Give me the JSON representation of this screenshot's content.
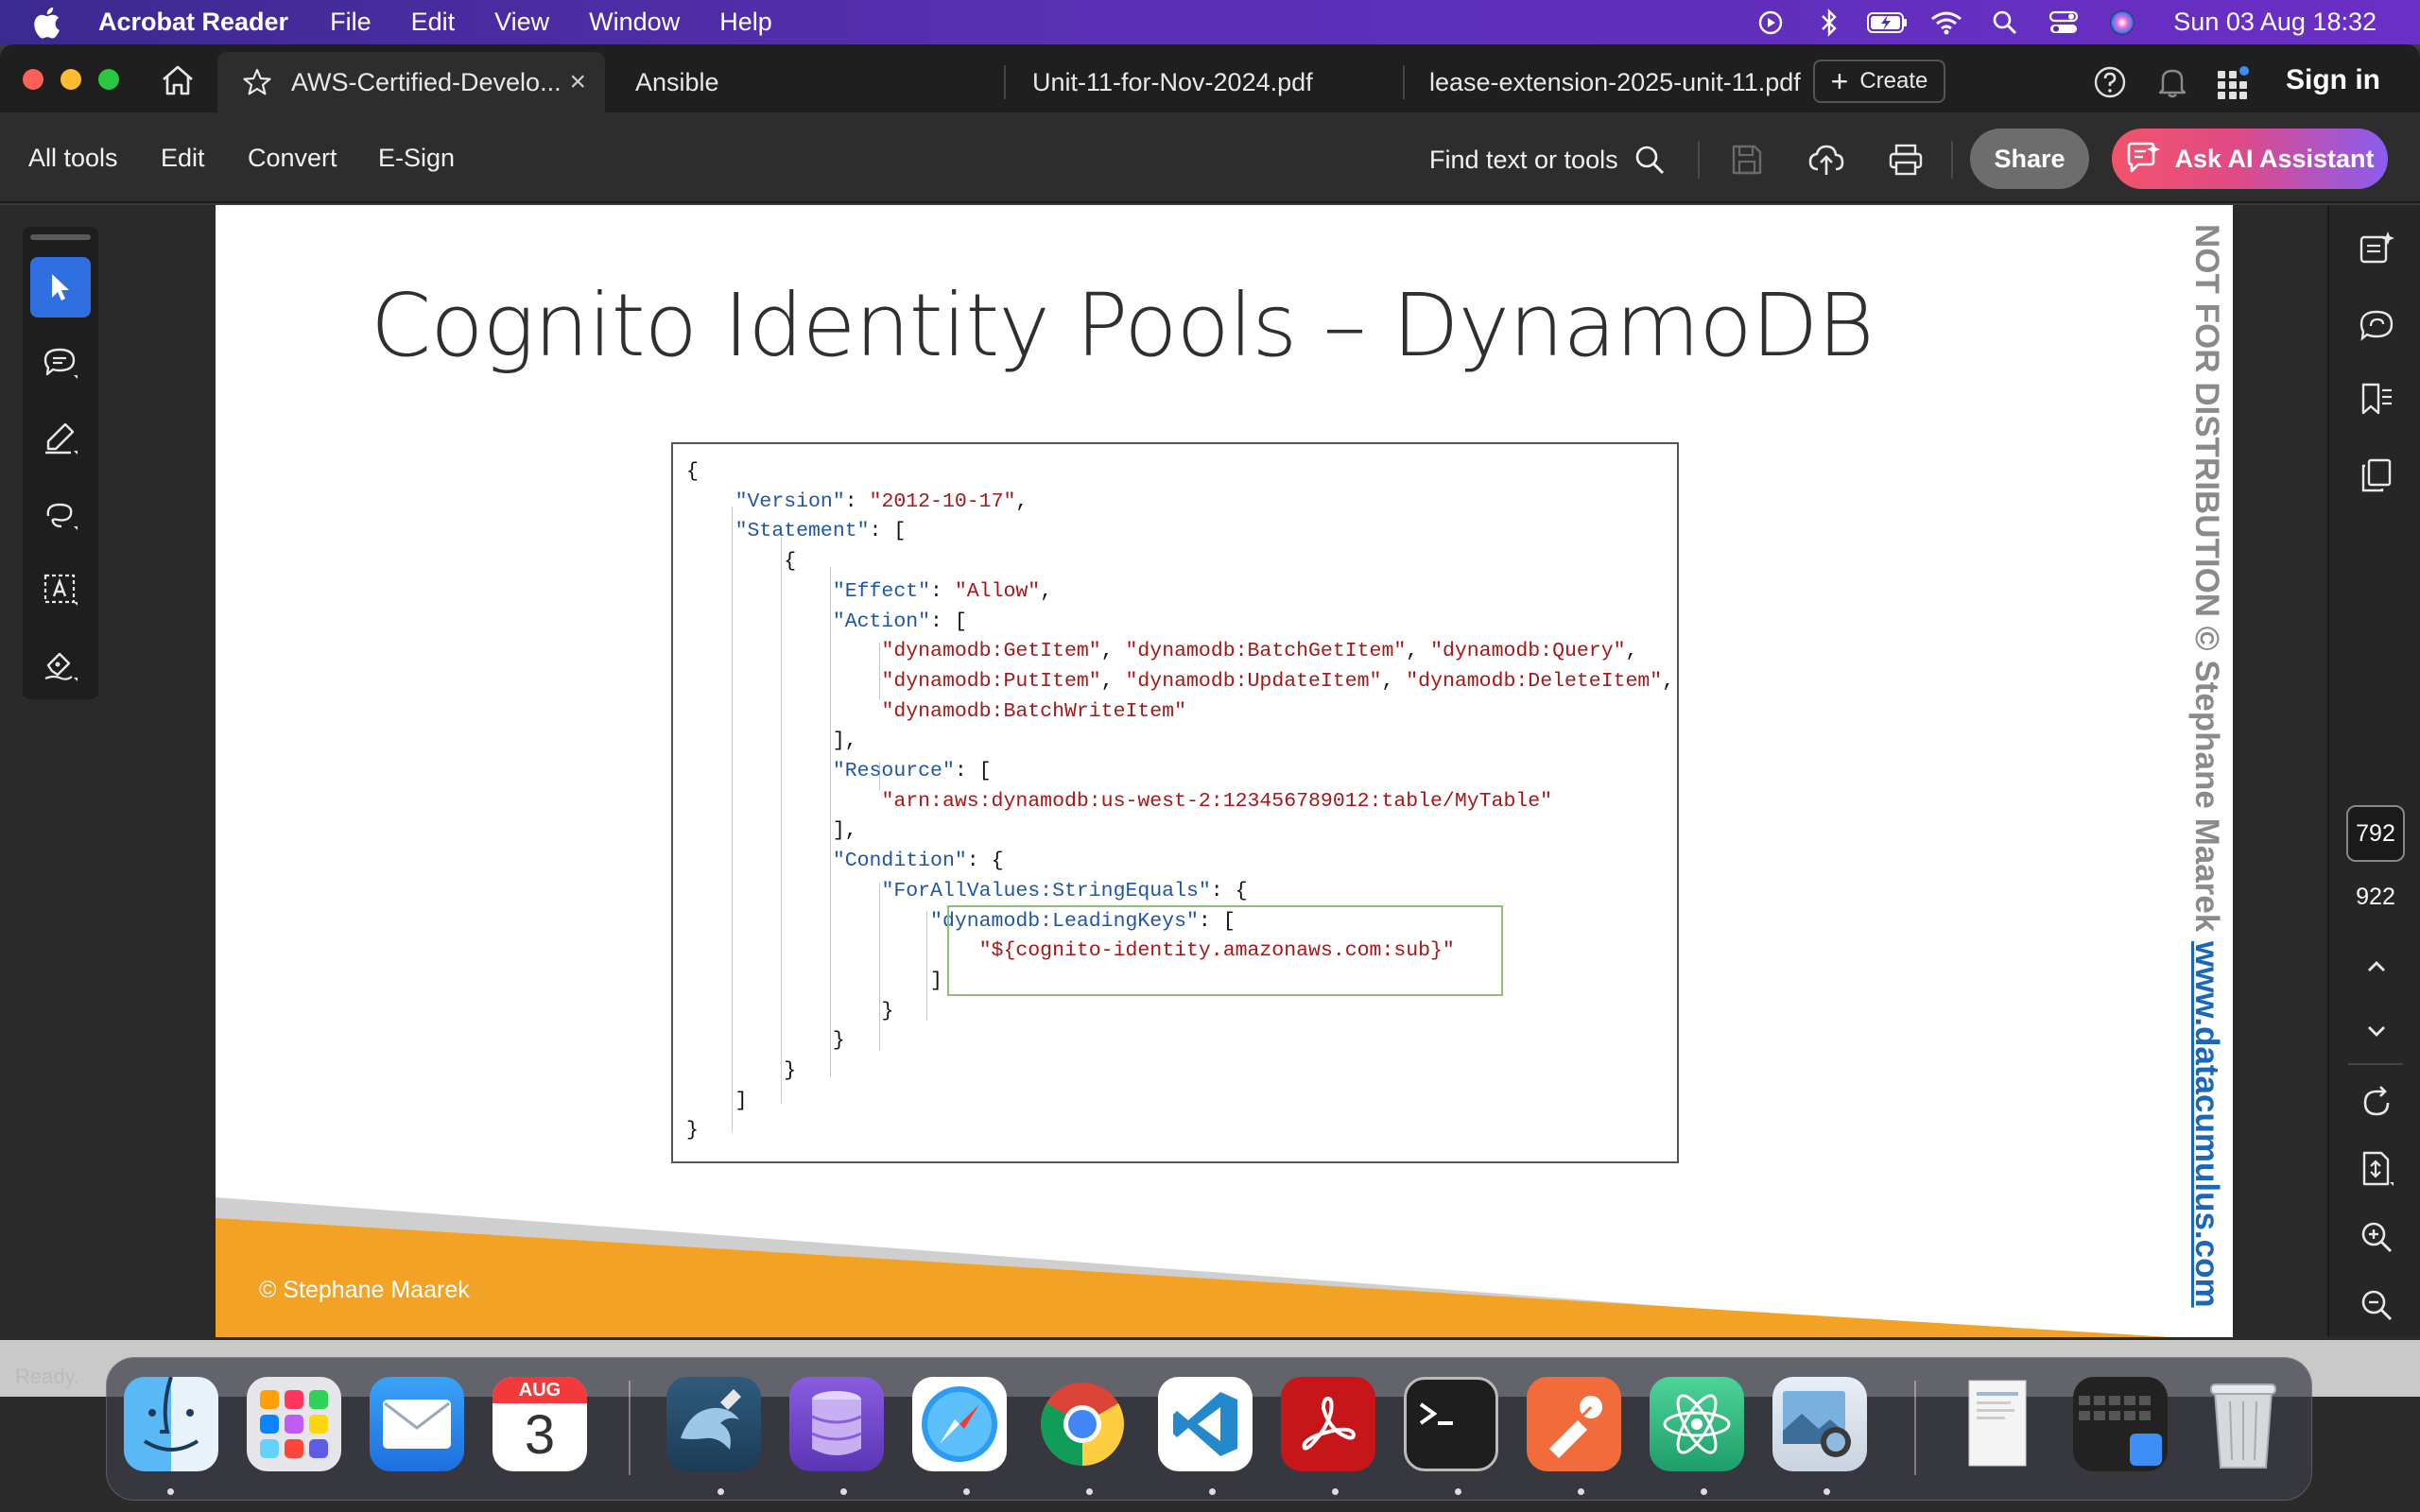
{
  "menubar": {
    "app_name": "Acrobat Reader",
    "menus": [
      "File",
      "Edit",
      "View",
      "Window",
      "Help"
    ],
    "clock": "Sun 03 Aug  18:32",
    "status_icons": [
      "play-icon",
      "bluetooth-icon",
      "battery-icon",
      "wifi-icon",
      "spotlight-icon",
      "control-center-icon",
      "siri-icon"
    ]
  },
  "tabs": {
    "active_title": "AWS-Certified-Develo...",
    "close_glyph": "×",
    "tab2": "Ansible",
    "tab3": "Unit-11-for-Nov-2024.pdf",
    "tab4": "lease-extension-2025-unit-11.pdf",
    "create_label": "Create",
    "create_glyph": "+",
    "sign_in": "Sign in"
  },
  "toolbar": {
    "all_tools": "All tools",
    "edit": "Edit",
    "convert": "Convert",
    "esign": "E-Sign",
    "find": "Find text or tools",
    "share": "Share",
    "ai": "Ask AI Assistant"
  },
  "slide": {
    "title": "Cognito Identity Pools – DynamoDB",
    "footer": "© Stephane Maarek",
    "watermark_gray": "NOT FOR DISTRIBUTION © Stephane Maarek ",
    "watermark_blue": "www.datacumulus.com"
  },
  "code": {
    "l1": "{",
    "version_key": "\"Version\"",
    "version_val": "\"2012-10-17\"",
    "statement_key": "\"Statement\"",
    "l4": "{",
    "effect_key": "\"Effect\"",
    "effect_val": "\"Allow\"",
    "action_key": "\"Action\"",
    "a1": "\"dynamodb:GetItem\"",
    "a2": "\"dynamodb:BatchGetItem\"",
    "a3": "\"dynamodb:Query\"",
    "a4": "\"dynamodb:PutItem\"",
    "a5": "\"dynamodb:UpdateItem\"",
    "a6": "\"dynamodb:DeleteItem\"",
    "a7": "\"dynamodb:BatchWriteItem\"",
    "l11": "],",
    "resource_key": "\"Resource\"",
    "resource_val": "\"arn:aws:dynamodb:us-west-2:123456789012:table/MyTable\"",
    "l14": "],",
    "condition_key": "\"Condition\"",
    "forall_key": "\"ForAllValues:StringEquals\"",
    "leading_key": "\"dynamodb:LeadingKeys\"",
    "leading_val": "\"${cognito-identity.amazonaws.com:sub}\"",
    "l19": "]",
    "l20": "}",
    "l21": "}",
    "l22": "}",
    "l23": "]",
    "l24": "}"
  },
  "pagenav": {
    "current": "792",
    "total": "922"
  },
  "status": {
    "ready": "Ready."
  },
  "dock": {
    "calendar_month": "AUG",
    "calendar_day": "3",
    "apps": [
      "finder",
      "launchpad",
      "mail",
      "calendar",
      "mysql-workbench",
      "db-browser",
      "safari",
      "chrome",
      "vscode",
      "acrobat",
      "terminal",
      "postman",
      "atom",
      "preview"
    ]
  },
  "colors": {
    "menubar": "#4b2ea6",
    "accent_blue": "#2f6fe0",
    "footer_orange": "#f2a325",
    "code_key": "#1d56a8",
    "code_string": "#a81616",
    "watermark_blue": "#1a66b8"
  }
}
